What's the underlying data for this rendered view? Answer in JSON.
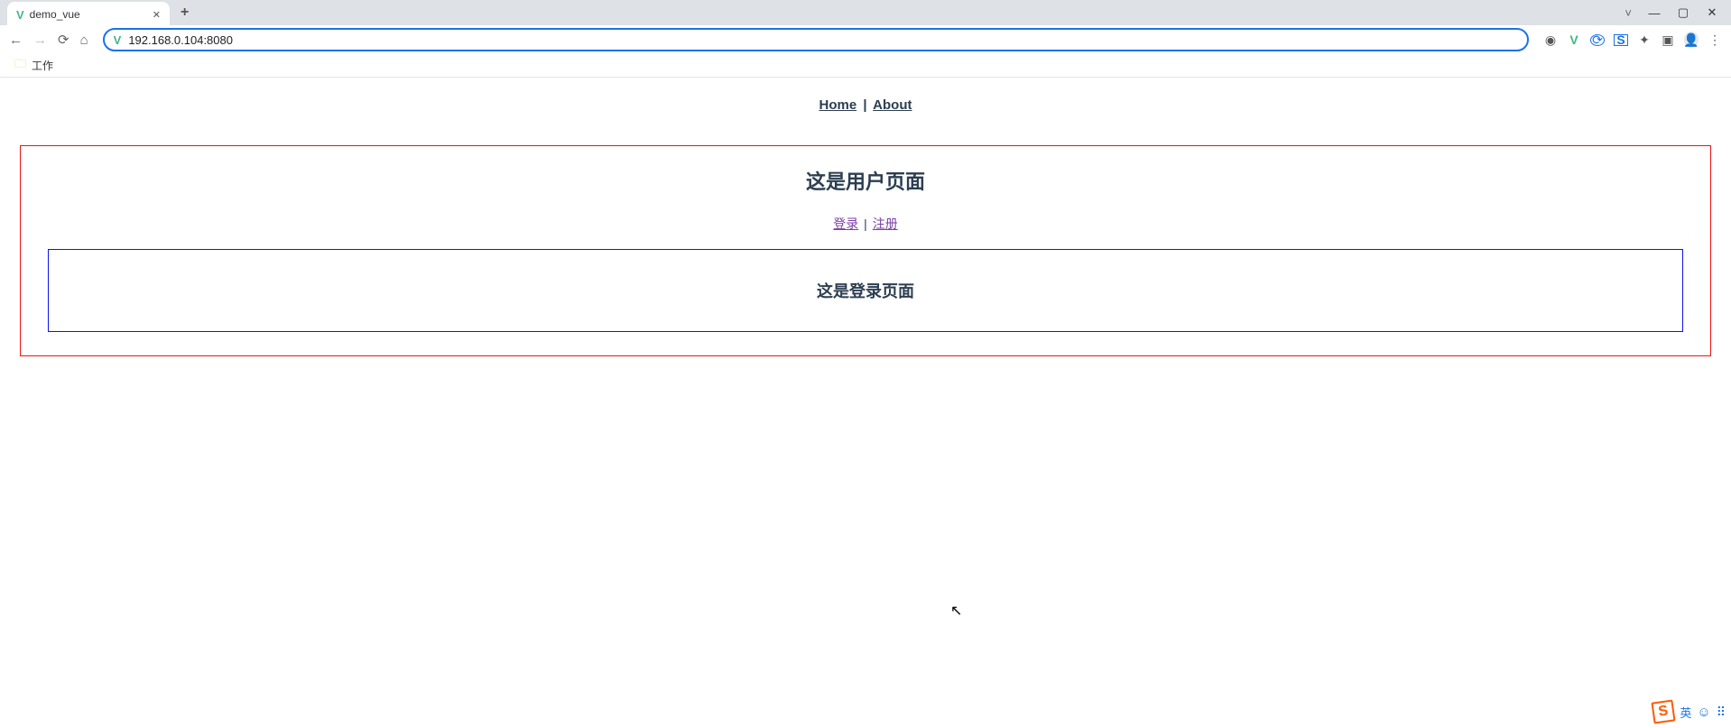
{
  "browser": {
    "tab_title": "demo_vue",
    "url": "192.168.0.104:8080",
    "bookmark_label": "工作"
  },
  "page": {
    "nav": {
      "home": "Home",
      "about": "About"
    },
    "user_box": {
      "heading": "这是用户页面",
      "login": "登录",
      "register": "注册",
      "login_heading": "这是登录页面"
    }
  },
  "ime": {
    "lang": "英"
  }
}
